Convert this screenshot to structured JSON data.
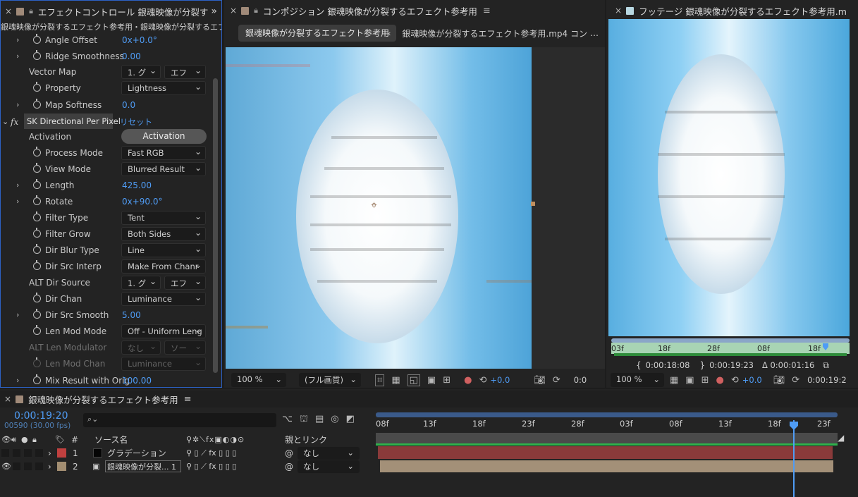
{
  "effect_controls": {
    "tab_title": "エフェクトコントロール 銀魂映像が分裂す",
    "expand": "»",
    "breadcrumb": "銀魂映像が分裂するエフェクト参考用・銀魂映像が分裂するエフェクト",
    "rows": [
      {
        "label": "Angle Offset",
        "value": "0x+0.0°",
        "kind": "value",
        "twirl": true,
        "stopwatch": true
      },
      {
        "label": "Ridge Smoothness",
        "value": "0.00",
        "kind": "value",
        "twirl": true,
        "stopwatch": true
      },
      {
        "label": "Vector Map",
        "kind": "dual",
        "dd1": "1. グ",
        "dd2": "エフ"
      },
      {
        "label": "Property",
        "value": "Lightness",
        "kind": "dropdown",
        "stopwatch": true
      },
      {
        "label": "Map Softness",
        "value": "0.0",
        "kind": "value",
        "twirl": true,
        "stopwatch": true
      }
    ],
    "effect_header": {
      "fx": "fx",
      "name": "SK Directional Per Pixel",
      "reset": "リセット"
    },
    "activation": {
      "label": "Activation",
      "button": "Activation"
    },
    "params": [
      {
        "label": "Process Mode",
        "value": "Fast RGB",
        "kind": "dropdown"
      },
      {
        "label": "View Mode",
        "value": "Blurred Result",
        "kind": "dropdown"
      },
      {
        "label": "Length",
        "value": "425.00",
        "kind": "value",
        "twirl": true
      },
      {
        "label": "Rotate",
        "value": "0x+90.0°",
        "kind": "value",
        "twirl": true
      },
      {
        "label": "Filter Type",
        "value": "Tent",
        "kind": "dropdown"
      },
      {
        "label": "Filter Grow",
        "value": "Both Sides",
        "kind": "dropdown"
      },
      {
        "label": "Dir Blur Type",
        "value": "Line",
        "kind": "dropdown"
      },
      {
        "label": "Dir Src Interp",
        "value": "Make From Chanr",
        "kind": "dropdown"
      }
    ],
    "alt_dir_source": {
      "label": "ALT Dir Source",
      "dd1": "1. グ",
      "dd2": "エフ"
    },
    "params2": [
      {
        "label": "Dir Chan",
        "value": "Luminance",
        "kind": "dropdown"
      },
      {
        "label": "Dir Src Smooth",
        "value": "5.00",
        "kind": "value",
        "twirl": true
      },
      {
        "label": "Len Mod Mode",
        "value": "Off - Uniform Leng",
        "kind": "dropdown"
      }
    ],
    "alt_len_modulator": {
      "label": "ALT Len Modulator",
      "dd1": "なし",
      "dd2": "ソー"
    },
    "len_mod_chan": {
      "label": "Len Mod Chan",
      "value": "Luminance"
    },
    "mix_result": {
      "label": "Mix Result with Orig",
      "value": "100.00"
    }
  },
  "composition": {
    "tab_title": "コンポジション 銀魂映像が分裂するエフェクト参考用",
    "tab_active": "銀魂映像が分裂するエフェクト参考用",
    "tab_other": "銀魂映像が分裂するエフェクト参考用.mp4 コン",
    "zoom": "100 %",
    "resolution": "(フル画質)",
    "exposure": "+0.0",
    "timecode_short": "0:0"
  },
  "footage": {
    "tab_title": "フッテージ 銀魂映像が分裂するエフェクト参考用.m",
    "ruler": [
      "03f",
      "18f",
      "28f",
      "08f",
      "18f"
    ],
    "in_point": "0:00:18:08",
    "out_point": "0:00:19:23",
    "duration": "Δ 0:00:01:16",
    "zoom": "100 %",
    "exposure": "+0.0",
    "timecode": "0:00:19:2"
  },
  "timeline": {
    "tab_title": "銀魂映像が分裂するエフェクト参考用",
    "current_time": "0:00:19:20",
    "frames": "00590 (30.00 fps)",
    "search_placeholder": "",
    "col_num": "#",
    "col_source": "ソース名",
    "col_parent": "親とリンク",
    "ruler": [
      "08f",
      "13f",
      "18f",
      "23f",
      "28f",
      "03f",
      "08f",
      "13f",
      "18f",
      "23f"
    ],
    "layers": [
      {
        "num": "1",
        "name": "グラデーション",
        "parent": "なし",
        "color": "#c0403f"
      },
      {
        "num": "2",
        "name": "銀魂映像が分裂... 1",
        "parent": "なし",
        "color": "#a38e72"
      }
    ]
  },
  "colors": {
    "accent": "#4f9cf5",
    "panel": "#232323",
    "focus_border": "#2c62c6",
    "layer1": "#8a3a3a",
    "layer2": "#a39078"
  }
}
